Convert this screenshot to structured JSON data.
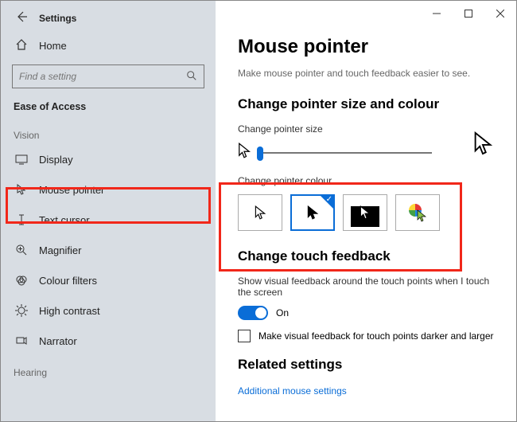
{
  "app_title": "Settings",
  "home_label": "Home",
  "search_placeholder": "Find a setting",
  "section_head": "Ease of Access",
  "group_vision": "Vision",
  "group_hearing": "Hearing",
  "nav": {
    "display": "Display",
    "mouse_pointer": "Mouse pointer",
    "text_cursor": "Text cursor",
    "magnifier": "Magnifier",
    "colour_filters": "Colour filters",
    "high_contrast": "High contrast",
    "narrator": "Narrator"
  },
  "page": {
    "title": "Mouse pointer",
    "subtitle": "Make mouse pointer and touch feedback easier to see.",
    "size_colour_heading": "Change pointer size and colour",
    "size_label": "Change pointer size",
    "colour_label": "Change pointer colour",
    "selected_colour_index": 1,
    "touch_heading": "Change touch feedback",
    "touch_desc": "Show visual feedback around the touch points when I touch the screen",
    "toggle_state": "On",
    "darker_label": "Make visual feedback for touch points darker and larger",
    "related_heading": "Related settings",
    "related_link": "Additional mouse settings"
  }
}
